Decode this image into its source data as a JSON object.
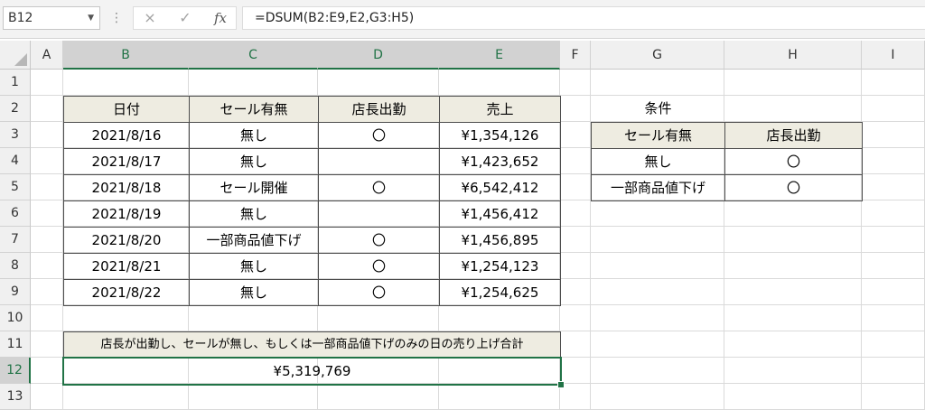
{
  "formula_bar": {
    "name_box": "B12",
    "cancel_icon": "×",
    "enter_icon": "✓",
    "fx_label": "fx",
    "formula": "=DSUM(B2:E9,E2,G3:H5)"
  },
  "columns": [
    "A",
    "B",
    "C",
    "D",
    "E",
    "F",
    "G",
    "H",
    "I"
  ],
  "rows": [
    "1",
    "2",
    "3",
    "4",
    "5",
    "6",
    "7",
    "8",
    "9",
    "10",
    "11",
    "12",
    "13"
  ],
  "table": {
    "headers": [
      "日付",
      "セール有無",
      "店長出勤",
      "売上"
    ],
    "rows": [
      [
        "2021/8/16",
        "無し",
        "〇",
        "¥1,354,126"
      ],
      [
        "2021/8/17",
        "無し",
        "",
        "¥1,423,652"
      ],
      [
        "2021/8/18",
        "セール開催",
        "〇",
        "¥6,542,412"
      ],
      [
        "2021/8/19",
        "無し",
        "",
        "¥1,456,412"
      ],
      [
        "2021/8/20",
        "一部商品値下げ",
        "〇",
        "¥1,456,895"
      ],
      [
        "2021/8/21",
        "無し",
        "〇",
        "¥1,254,123"
      ],
      [
        "2021/8/22",
        "無し",
        "〇",
        "¥1,254,625"
      ]
    ]
  },
  "criteria": {
    "title": "条件",
    "headers": [
      "セール有無",
      "店長出勤"
    ],
    "rows": [
      [
        "無し",
        "〇"
      ],
      [
        "一部商品値下げ",
        "〇"
      ]
    ]
  },
  "summary": {
    "label": "店長が出勤し、セールが無し、もしくは一部商品値下げのみの日の売り上げ合計",
    "value": "¥5,319,769"
  },
  "colors": {
    "accent": "#217346",
    "header_fill": "#eeece1"
  }
}
